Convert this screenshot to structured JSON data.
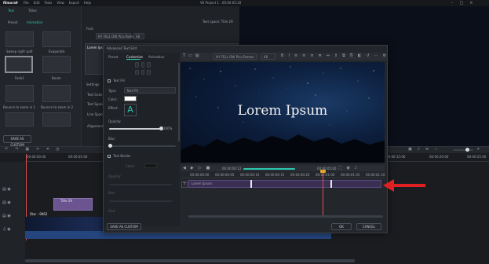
{
  "app": {
    "logo": "filmora9",
    "project_title": "VE Project 1 : 00:00:05:20"
  },
  "menu": [
    "File",
    "Edit",
    "Tools",
    "View",
    "Export",
    "Help"
  ],
  "left_panel": {
    "tabs": [
      "Text",
      "Titles"
    ],
    "subtabs": [
      "Preset",
      "Animation"
    ],
    "presets": [
      "Sweep right split",
      "Evaporate",
      "Fade1",
      "Boom",
      "Bounce to zoom in 1",
      "Bounce to zoom in 2",
      "",
      ""
    ],
    "save_custom": "SAVE AS CUSTOM"
  },
  "mid_panel": {
    "title": "Text space: Title 29",
    "font_label": "Font",
    "font_name": "HY FELL DW Pica Roman",
    "font_size": "48",
    "text_content": "Lorem Ipsum",
    "settings_label": "Settings",
    "rows": [
      "Text Color",
      "Text Spacing",
      "Line Spacing",
      "Alignment"
    ]
  },
  "dialog": {
    "title": "Advanced Text Edit",
    "tabs": [
      "Preset",
      "Customize",
      "Animation"
    ],
    "text_fill": "Text Fill",
    "type_label": "Type:",
    "type_value": "Text Fill",
    "color_label": "Color:",
    "effect_label": "Effect:",
    "opacity_label": "Opacity:",
    "opacity_value": "100%",
    "blur_label": "Blur:",
    "text_border": "Text Border",
    "border_rows": [
      "Color:",
      "Opacity:",
      "Blur:",
      "Size:"
    ],
    "font_name": "HY FELL DW Pica Roman",
    "font_size": "48",
    "preview_text": "Lorem Ipsum",
    "timecode_current": "00:00:00:12",
    "timecode_total": "00:00:05:00",
    "ruler_ticks": [
      "00:00:00:00",
      "00:00:00:05",
      "00:00:00:10",
      "00:00:00:15",
      "00:00:00:20",
      "00:00:01:00",
      "00:00:01:05",
      "00:00:01:10"
    ],
    "text_track_label": "Lorem Ipsum",
    "save_custom": "SAVE AS CUSTOM",
    "ok": "OK",
    "cancel": "CANCEL"
  },
  "timeline": {
    "ruler_ticks": [
      "00:00:00:00",
      "00:00:05:00",
      "00:00:10:00",
      "00:00:15:00",
      "00:00:20:00",
      "00:00:25:00"
    ],
    "title_clip": "Title 29",
    "video_clip": "Star - 9062"
  },
  "colors": {
    "accent": "#2bc7b0",
    "playhead": "#e05252",
    "arrow": "#e02020",
    "title_clip": "#6b5490",
    "video_clip": "#24457e"
  }
}
